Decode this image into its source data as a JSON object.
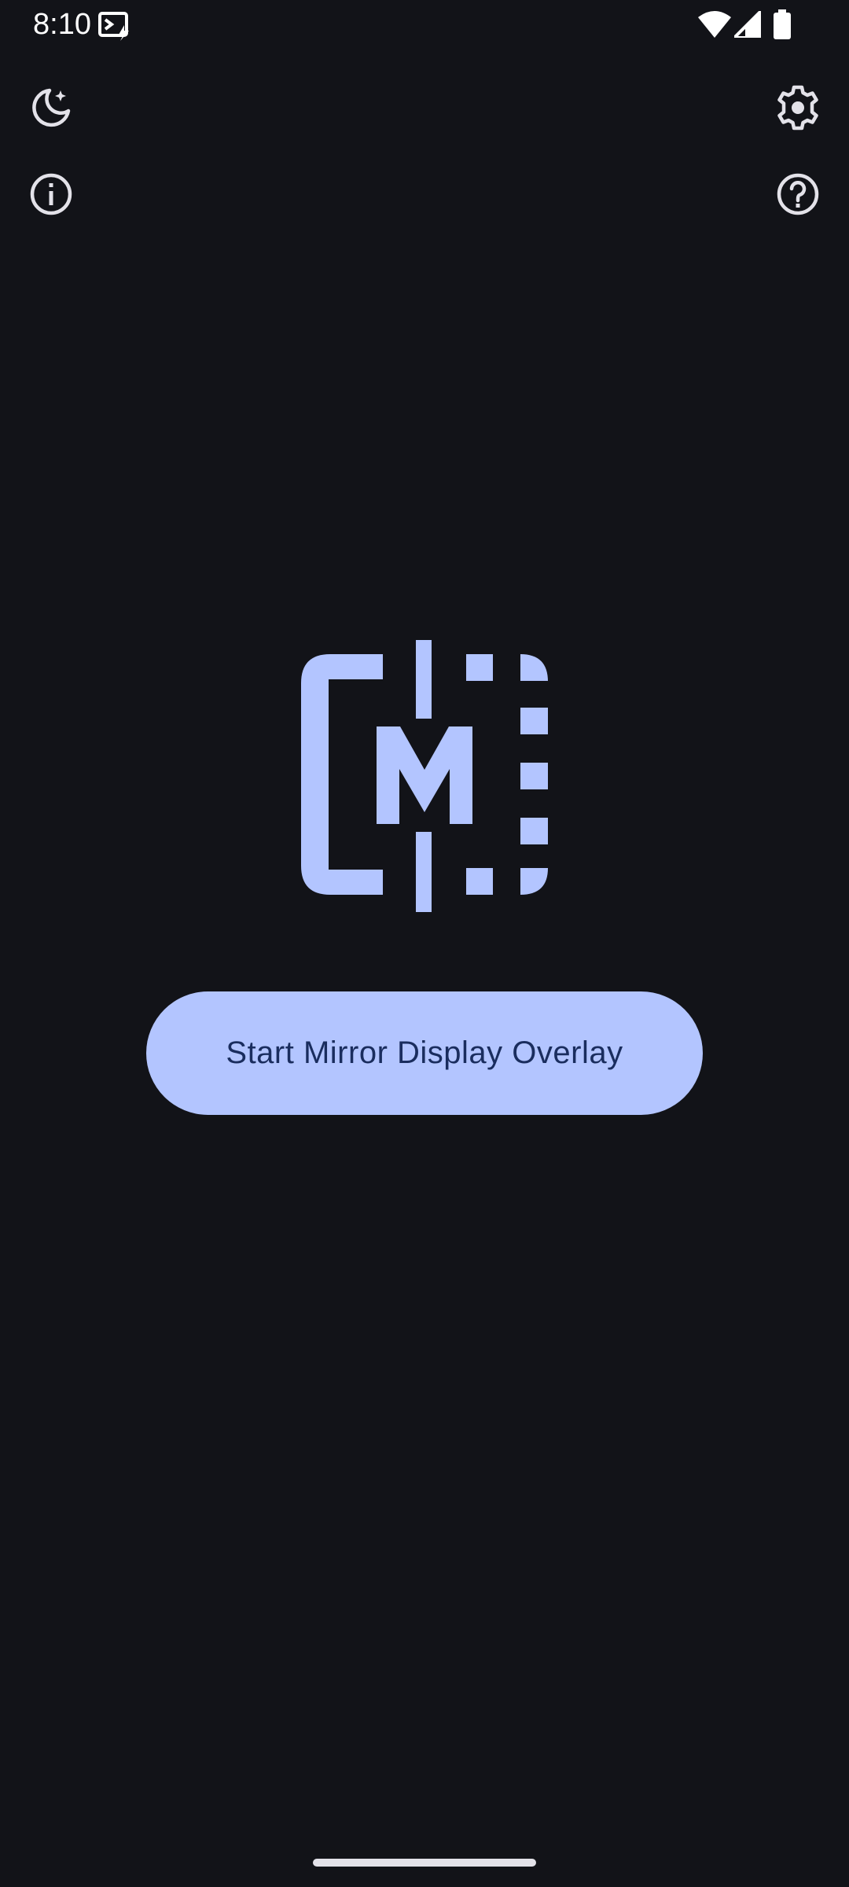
{
  "status_bar": {
    "time": "8:10",
    "icons": [
      "screen-cast-icon",
      "wifi-icon",
      "cellular-signal-icon",
      "battery-icon"
    ]
  },
  "toolbar": {
    "left_icons": [
      "dark-mode-icon",
      "info-icon"
    ],
    "right_icons": [
      "settings-gear-icon",
      "help-icon"
    ]
  },
  "logo": {
    "letter": "M",
    "icon": "mirror-display-logo-icon"
  },
  "main": {
    "start_button_label": "Start Mirror Display Overlay"
  },
  "colors": {
    "background": "#121318",
    "accent": "#b3c5ff",
    "button_text": "#1a2d5e",
    "icon": "#e3e2e9"
  }
}
